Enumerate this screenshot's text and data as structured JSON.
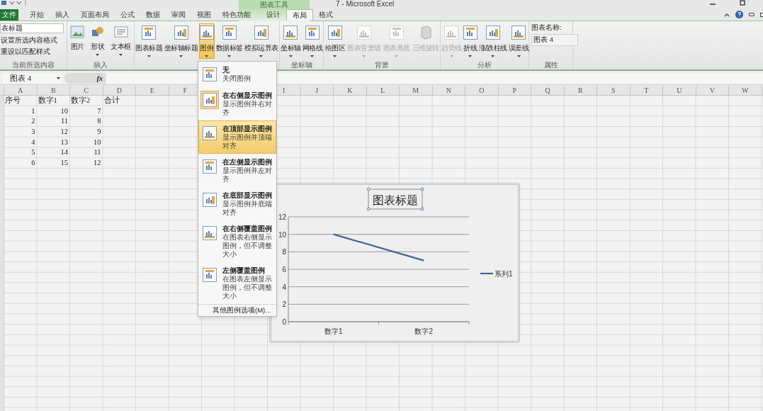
{
  "title_bar": {
    "title": "7 - Microsoft Excel",
    "context_group": "图表工具"
  },
  "tabs": [
    {
      "label": "文件",
      "kind": "file",
      "selected": false
    },
    {
      "label": "开始",
      "kind": "normal",
      "selected": false
    },
    {
      "label": "插入",
      "kind": "normal",
      "selected": false
    },
    {
      "label": "页面布局",
      "kind": "normal",
      "selected": false
    },
    {
      "label": "公式",
      "kind": "normal",
      "selected": false
    },
    {
      "label": "数据",
      "kind": "normal",
      "selected": false
    },
    {
      "label": "审阅",
      "kind": "normal",
      "selected": false
    },
    {
      "label": "视图",
      "kind": "normal",
      "selected": false
    },
    {
      "label": "特色功能",
      "kind": "normal",
      "selected": false
    },
    {
      "label": "设计",
      "kind": "context",
      "selected": false
    },
    {
      "label": "布局",
      "kind": "context",
      "selected": true
    },
    {
      "label": "格式",
      "kind": "context",
      "selected": false
    }
  ],
  "ribbon": {
    "groups": [
      {
        "kind": "selection",
        "label": "当前所选内容",
        "items": [
          {
            "label": "表标题",
            "kind": "dropdown"
          },
          {
            "label": "设置所选内容格式",
            "kind": "small"
          },
          {
            "label": "重设以匹配样式",
            "kind": "small"
          }
        ]
      },
      {
        "kind": "buttons",
        "label": "插入",
        "items": [
          {
            "label": "图片",
            "kind": "picture",
            "dropdown": false,
            "disabled": false,
            "selected": false
          },
          {
            "label": "形状",
            "kind": "shapes",
            "dropdown": true,
            "disabled": false,
            "selected": false
          },
          {
            "label": "文本框",
            "kind": "textbox",
            "dropdown": true,
            "disabled": false,
            "selected": false
          }
        ]
      },
      {
        "kind": "buttons",
        "items": [
          {
            "label": "图表标题",
            "kind": "chart",
            "dropdown": true,
            "disabled": false,
            "selected": false
          },
          {
            "label": "坐标轴标题",
            "kind": "chart",
            "dropdown": true,
            "disabled": false,
            "selected": false
          },
          {
            "label": "图例",
            "kind": "chart",
            "dropdown": true,
            "disabled": false,
            "selected": true
          },
          {
            "label": "数据标签",
            "kind": "chart",
            "dropdown": true,
            "disabled": false,
            "selected": false
          },
          {
            "label": "模拟运算表",
            "kind": "chart",
            "dropdown": true,
            "disabled": false,
            "selected": false
          }
        ]
      },
      {
        "kind": "buttons",
        "label": "坐标轴",
        "items": [
          {
            "label": "坐标轴",
            "kind": "chart",
            "dropdown": true,
            "disabled": false,
            "selected": false
          },
          {
            "label": "网格线",
            "kind": "chart",
            "dropdown": true,
            "disabled": false,
            "selected": false
          }
        ]
      },
      {
        "kind": "buttons",
        "label": "背景",
        "items": [
          {
            "label": "绘图区",
            "kind": "chart",
            "dropdown": true,
            "disabled": false,
            "selected": false
          },
          {
            "label": "图表背景墙",
            "kind": "chart",
            "dropdown": true,
            "disabled": true,
            "selected": false
          },
          {
            "label": "图表基底",
            "kind": "chart",
            "dropdown": true,
            "disabled": true,
            "selected": false
          },
          {
            "label": "三维旋转",
            "kind": "cube",
            "dropdown": false,
            "disabled": true,
            "selected": false
          }
        ]
      },
      {
        "kind": "buttons",
        "label": "分析",
        "items": [
          {
            "label": "趋势线",
            "kind": "chart",
            "dropdown": true,
            "disabled": true,
            "selected": false
          },
          {
            "label": "折线",
            "kind": "chart",
            "dropdown": true,
            "disabled": false,
            "selected": false
          },
          {
            "label": "涨/跌柱线",
            "kind": "chart",
            "dropdown": true,
            "disabled": false,
            "selected": false
          },
          {
            "label": "误差线",
            "kind": "chart",
            "dropdown": true,
            "disabled": false,
            "selected": false
          }
        ]
      },
      {
        "kind": "properties",
        "label": "属性",
        "field_label": "图表名称:",
        "value": "图表 4"
      }
    ]
  },
  "formula_bar": {
    "name_box": "图表 4",
    "fx": "fx"
  },
  "sheet": {
    "columns_left": [
      "A",
      "B",
      "C",
      "D",
      "E",
      "F"
    ],
    "columns_right": [
      "I",
      "J",
      "K",
      "L",
      "M",
      "N",
      "O",
      "P",
      "Q",
      "R",
      "S",
      "T",
      "U",
      "V",
      "W"
    ],
    "rows": [
      {
        "kind": "text",
        "cells": [
          "序号",
          "数字1",
          "数字2",
          "合计"
        ]
      },
      {
        "kind": "number",
        "cells": [
          "1",
          "10",
          "7"
        ]
      },
      {
        "kind": "number",
        "cells": [
          "2",
          "11",
          "8"
        ]
      },
      {
        "kind": "number",
        "cells": [
          "3",
          "12",
          "9"
        ]
      },
      {
        "kind": "number",
        "cells": [
          "4",
          "13",
          "10"
        ]
      },
      {
        "kind": "number",
        "cells": [
          "5",
          "14",
          "11"
        ]
      },
      {
        "kind": "number",
        "cells": [
          "6",
          "15",
          "12"
        ]
      }
    ]
  },
  "chart": {
    "title": "图表标题",
    "chart_data": {
      "type": "line",
      "categories": [
        "数字1",
        "数字2"
      ],
      "series": [
        {
          "name": "系列1",
          "color": "#3e6596",
          "values": [
            10,
            7
          ]
        }
      ],
      "ylim": [
        0,
        12
      ],
      "yticks": [
        0,
        2,
        4,
        6,
        8,
        10,
        12
      ],
      "grid": true
    }
  },
  "legend_menu": {
    "items": [
      {
        "title": "无",
        "description": "关闭图例",
        "selected": false,
        "highlighted": false
      },
      {
        "title": "在右侧显示图例",
        "description": "显示图例并右对齐",
        "selected": true,
        "highlighted": false
      },
      {
        "title": "在顶部显示图例",
        "description": "显示图例并顶端对齐",
        "selected": false,
        "highlighted": true
      },
      {
        "title": "在左侧显示图例",
        "description": "显示图例并左对齐",
        "selected": false,
        "highlighted": false
      },
      {
        "title": "在底部显示图例",
        "description": "显示图例并底端对齐",
        "selected": false,
        "highlighted": false
      },
      {
        "title": "在右侧覆盖图例",
        "description": "在图表右侧显示图例，但不调整大小",
        "selected": false,
        "highlighted": false
      },
      {
        "title": "左侧覆盖图例",
        "description": "在图表左侧显示图例，但不调整大小",
        "selected": false,
        "highlighted": false
      }
    ],
    "footer": "其他图例选项(M)..."
  }
}
